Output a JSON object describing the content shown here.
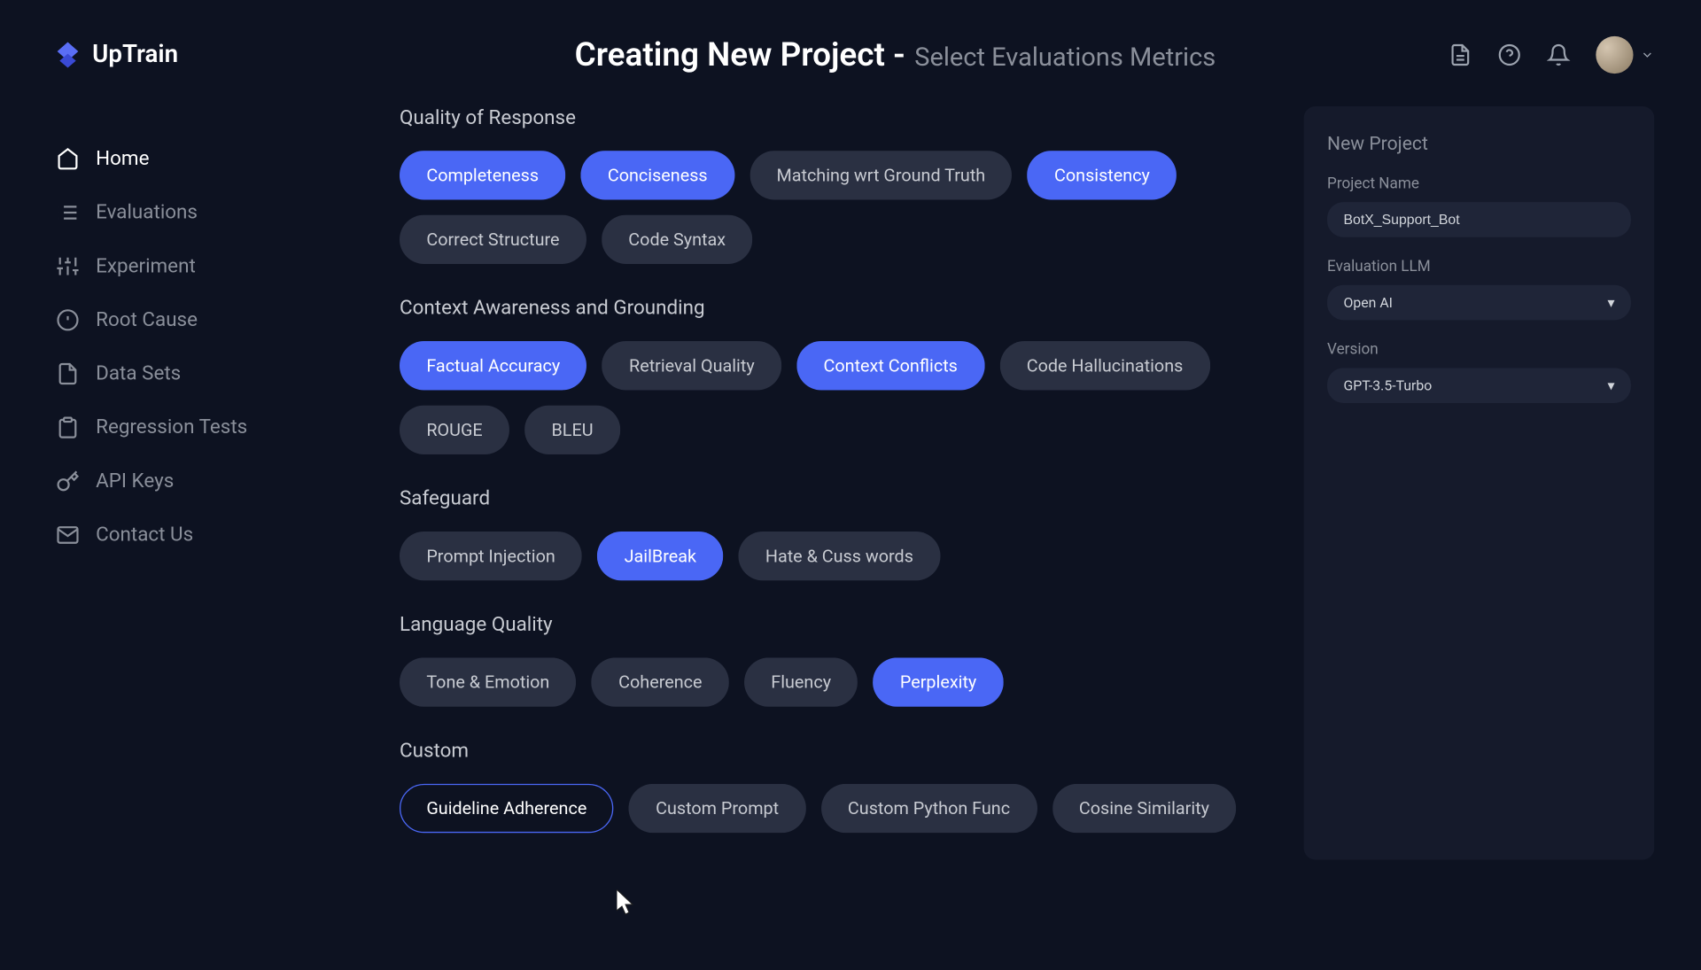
{
  "brand": "UpTrain",
  "header": {
    "title": "Creating New Project -",
    "subtitle": "Select Evaluations Metrics"
  },
  "nav": {
    "items": [
      {
        "label": "Home",
        "active": true
      },
      {
        "label": "Evaluations"
      },
      {
        "label": "Experiment"
      },
      {
        "label": "Root Cause"
      },
      {
        "label": "Data Sets"
      },
      {
        "label": "Regression Tests"
      },
      {
        "label": "API Keys"
      },
      {
        "label": "Contact Us"
      }
    ]
  },
  "sections": [
    {
      "title": "Quality of Response",
      "chips": [
        {
          "label": "Completeness",
          "state": "selected"
        },
        {
          "label": "Conciseness",
          "state": "selected"
        },
        {
          "label": "Matching wrt Ground Truth",
          "state": ""
        },
        {
          "label": "Consistency",
          "state": "selected"
        },
        {
          "label": "Correct Structure",
          "state": ""
        },
        {
          "label": "Code Syntax",
          "state": ""
        }
      ]
    },
    {
      "title": "Context Awareness and Grounding",
      "chips": [
        {
          "label": "Factual Accuracy",
          "state": "selected"
        },
        {
          "label": "Retrieval Quality",
          "state": ""
        },
        {
          "label": "Context Conflicts",
          "state": "selected"
        },
        {
          "label": "Code Hallucinations",
          "state": ""
        },
        {
          "label": "ROUGE",
          "state": ""
        },
        {
          "label": "BLEU",
          "state": ""
        }
      ]
    },
    {
      "title": "Safeguard",
      "chips": [
        {
          "label": "Prompt Injection",
          "state": ""
        },
        {
          "label": "JailBreak",
          "state": "selected"
        },
        {
          "label": "Hate & Cuss words",
          "state": ""
        }
      ]
    },
    {
      "title": "Language Quality",
      "chips": [
        {
          "label": "Tone & Emotion",
          "state": ""
        },
        {
          "label": "Coherence",
          "state": ""
        },
        {
          "label": "Fluency",
          "state": ""
        },
        {
          "label": "Perplexity",
          "state": "selected"
        }
      ]
    },
    {
      "title": "Custom",
      "chips": [
        {
          "label": "Guideline Adherence",
          "state": "outlined"
        },
        {
          "label": "Custom Prompt",
          "state": ""
        },
        {
          "label": "Custom Python Func",
          "state": ""
        },
        {
          "label": "Cosine Similarity",
          "state": ""
        }
      ]
    }
  ],
  "rightPanel": {
    "title": "New Project",
    "projectNameLabel": "Project Name",
    "projectNameValue": "BotX_Support_Bot",
    "evalLLMLabel": "Evaluation LLM",
    "evalLLMValue": "Open AI",
    "versionLabel": "Version",
    "versionValue": "GPT-3.5-Turbo"
  }
}
